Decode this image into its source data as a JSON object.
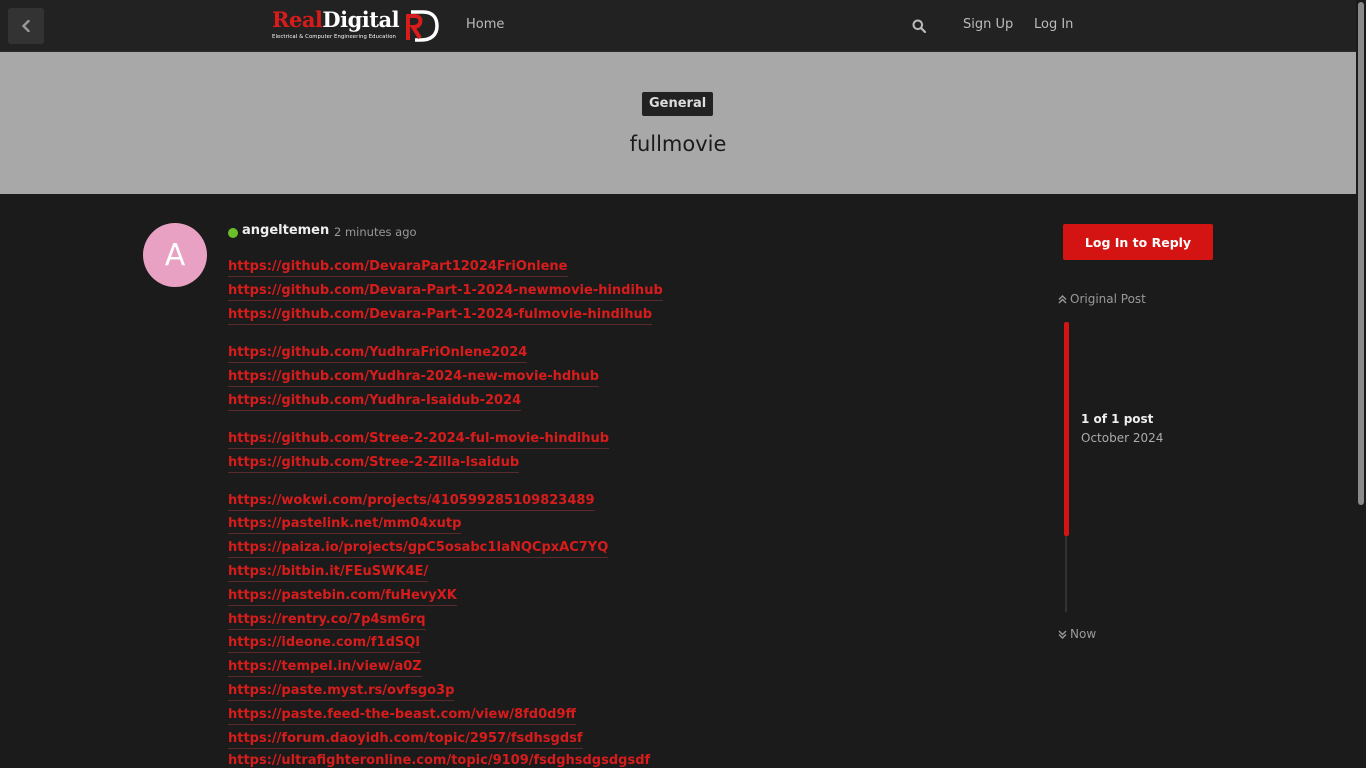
{
  "header": {
    "logo_part1": "Real",
    "logo_part2": "Digital",
    "logo_tagline": "Electrical & Computer Engineering Education",
    "home_label": "Home",
    "signup_label": "Sign Up",
    "login_label": "Log In"
  },
  "topic": {
    "category": "General",
    "title": "fullmovie"
  },
  "post": {
    "avatar_letter": "A",
    "username": "angeltemen",
    "time_ago": "2 minutes ago",
    "links": [
      "https://github.com/DevaraPart12024FriOnlene",
      "https://github.com/Devara-Part-1-2024-newmovie-hindihub",
      "https://github.com/Devara-Part-1-2024-fulmovie-hindihub",
      "https://github.com/YudhraFriOnlene2024",
      "https://github.com/Yudhra-2024-new-movie-hdhub",
      "https://github.com/Yudhra-Isaidub-2024",
      "https://github.com/Stree-2-2024-ful-movie-hindihub",
      "https://github.com/Stree-2-Zilla-Isaidub",
      "https://wokwi.com/projects/410599285109823489",
      "https://pastelink.net/mm04xutp",
      "https://paiza.io/projects/gpC5osabc1IaNQCpxAC7YQ",
      "https://bitbin.it/FEuSWK4E/",
      "https://pastebin.com/fuHevyXK",
      "https://rentry.co/7p4sm6rq",
      "https://ideone.com/f1dSQI",
      "https://tempel.in/view/a0Z",
      "https://paste.myst.rs/ovfsgo3p",
      "https://paste.feed-the-beast.com/view/8fd0d9ff",
      "https://forum.daoyidh.com/topic/2957/fsdhsgdsf",
      "https://ultrafighteronline.com/topic/9109/fsdghsdgsdgsdf"
    ]
  },
  "sidebar": {
    "reply_label": "Log In to Reply",
    "original_post_label": "Original Post",
    "post_count": "1 of 1 post",
    "month": "October 2024",
    "now_label": "Now"
  },
  "colors": {
    "accent": "#d41313",
    "header_bg": "#222222",
    "banner_bg": "#a8a8a8",
    "body_bg": "#1b1b1b",
    "avatar_bg": "#e8a1c3",
    "online": "#6bbf28"
  }
}
